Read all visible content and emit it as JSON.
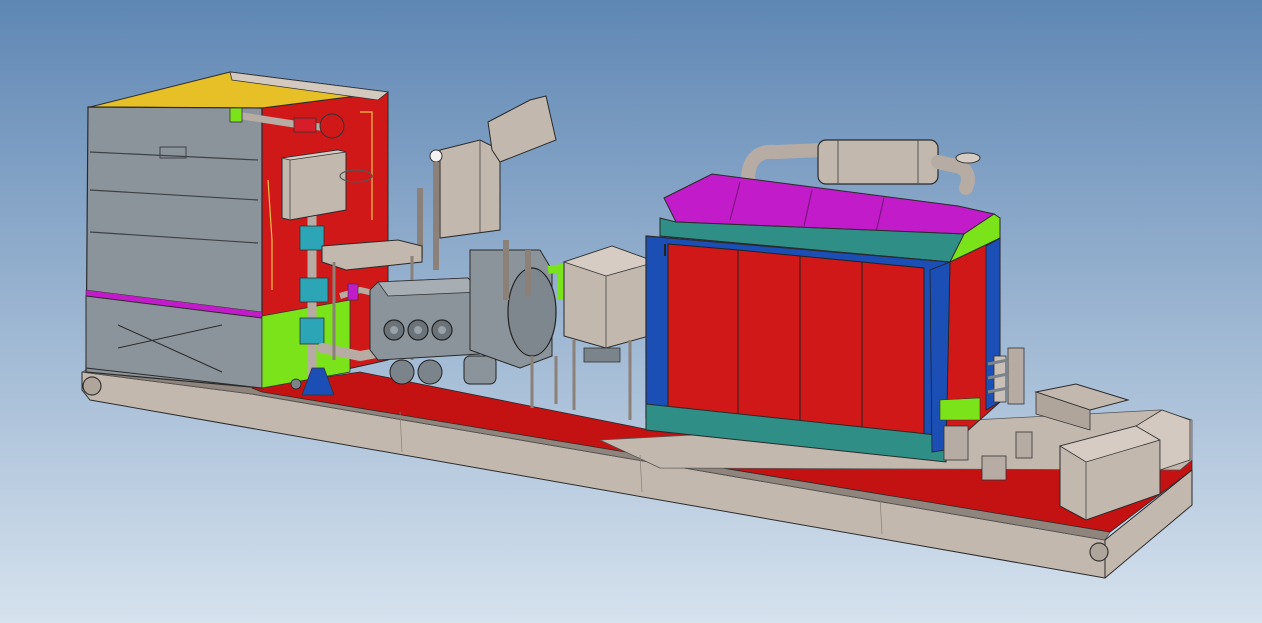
{
  "viewport": {
    "background_top": "#5f87b4",
    "background_bottom": "#d6e2ee"
  },
  "colors": {
    "skid_grey": "#c3b8ae",
    "skid_dark": "#8f857c",
    "skid_red": "#c41212",
    "panel_red": "#d01818",
    "panel_red_dark": "#8e0d0d",
    "magenta": "#c21bc9",
    "teal": "#2f8f86",
    "blue": "#1b4fb5",
    "lime": "#7be31a",
    "yellow": "#e7bf26",
    "cyan": "#2ca5b6",
    "steel_grey": "#8c949b",
    "steel_dark": "#5d646b",
    "edge": "#2a2a2a"
  },
  "components": [
    "skid-base",
    "tank",
    "hand-valve",
    "control-box",
    "pipework",
    "hopper",
    "plunger-pump",
    "gearbox",
    "exhaust-silencer",
    "power-unit-enclosure",
    "radiator",
    "electrical-cabinet"
  ]
}
